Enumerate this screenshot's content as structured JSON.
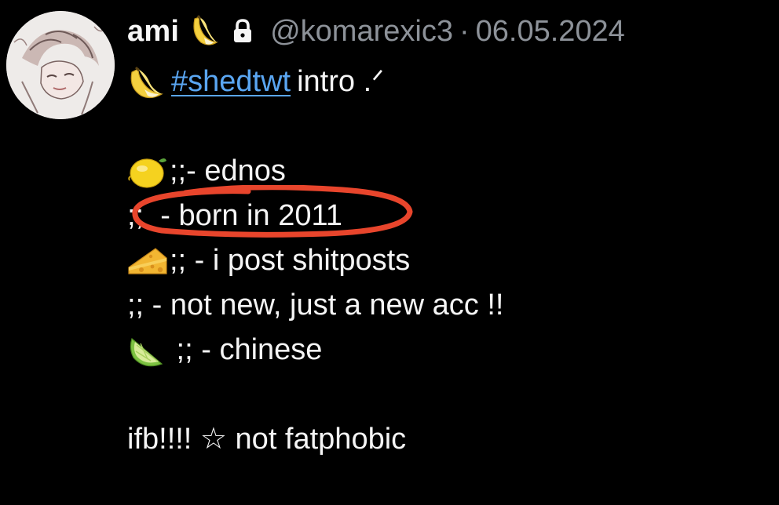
{
  "post": {
    "author": {
      "display_name": "ami",
      "name_emoji": "banana-icon",
      "protected_icon": "lock-icon",
      "handle": "@komarexic3",
      "separator": "·",
      "date": "06.05.2024"
    },
    "lines": [
      {
        "emoji": "banana-icon",
        "hashtag": "#shedtwt",
        "text": "intro .ᐟ"
      },
      {
        "emoji": "lemon-icon",
        "text": ";;- ednos"
      },
      {
        "emoji": "",
        "text": ";;  - born in 2011"
      },
      {
        "emoji": "cheese-icon",
        "text": ";; - i post shitposts"
      },
      {
        "emoji": "",
        "text": ";; - not new, just a new acc !!"
      },
      {
        "emoji": "lime-icon",
        "text": " ;; - chinese"
      },
      {
        "emoji": "",
        "text": "ifb!!!! ☆ not fatphobic"
      }
    ]
  },
  "annotation": {
    "color": "#e8452c",
    "target": "born in 2011"
  }
}
